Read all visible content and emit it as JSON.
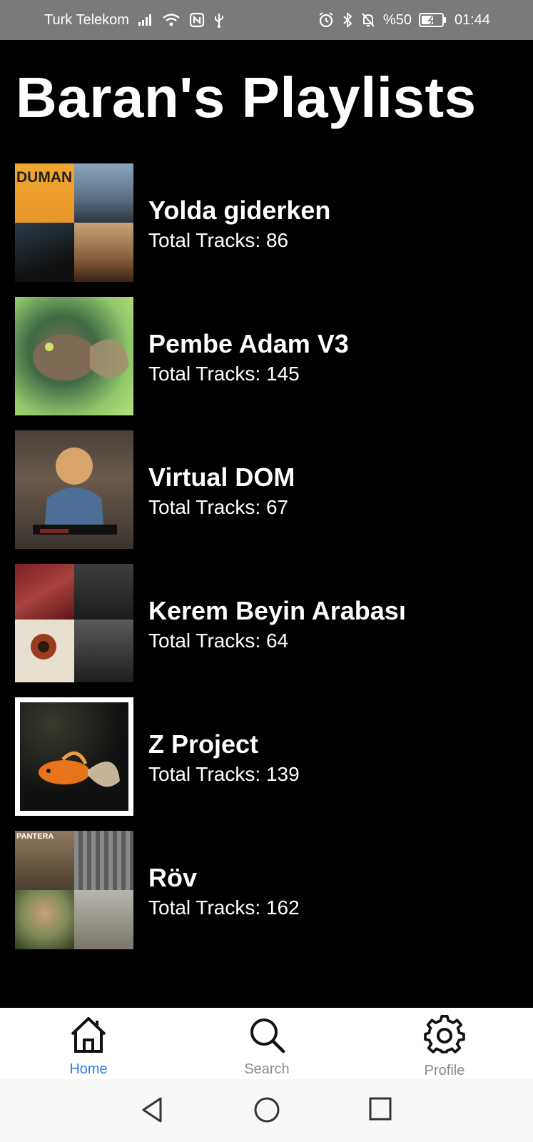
{
  "status_bar": {
    "carrier": "Turk Telekom",
    "battery_percent": "%50",
    "time": "01:44"
  },
  "header": {
    "title": "Baran's Playlists"
  },
  "playlists": [
    {
      "name": "Yolda giderken",
      "tracks_label": "Total Tracks: 86"
    },
    {
      "name": "Pembe Adam V3",
      "tracks_label": "Total Tracks: 145"
    },
    {
      "name": "Virtual DOM",
      "tracks_label": "Total Tracks: 67"
    },
    {
      "name": "Kerem Beyin Arabası",
      "tracks_label": "Total Tracks: 64"
    },
    {
      "name": "Z Project",
      "tracks_label": "Total Tracks: 139"
    },
    {
      "name": "Röv",
      "tracks_label": "Total Tracks: 162"
    }
  ],
  "bottom_nav": {
    "items": [
      {
        "label": "Home",
        "icon": "home-icon",
        "active": true
      },
      {
        "label": "Search",
        "icon": "search-icon",
        "active": false
      },
      {
        "label": "Profile",
        "icon": "gear-icon",
        "active": false
      }
    ]
  },
  "colors": {
    "background": "#000000",
    "status_bar": "#7a7a7a",
    "nav_active": "#2a7de1",
    "nav_inactive": "#8a8a8a"
  }
}
